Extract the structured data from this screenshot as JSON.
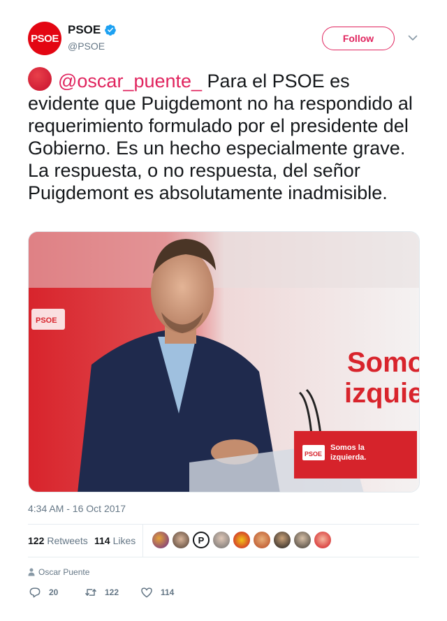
{
  "account": {
    "display_name": "PSOE",
    "handle": "@PSOE",
    "avatar_text": "PSOE",
    "verified": true
  },
  "follow_label": "Follow",
  "tweet": {
    "mention": "@oscar_puente_",
    "text": " Para el PSOE es evidente que Puigdemont no ha respondido al requerimiento formulado por el presidente del Gobierno. Es un hecho especialmente grave. La respuesta, o no respuesta, del señor Puigdemont es absolutamente inadmisible."
  },
  "media": {
    "podium_text_line1": "Somos la",
    "podium_text_line2": "izquierda.",
    "podium_logo": "PSOE",
    "wall_text_line1": "Somo",
    "wall_text_line2": "izquie",
    "wall_logo": "PSOE"
  },
  "timestamp": "4:34 AM - 16 Oct 2017",
  "stats": {
    "retweets_count": "122",
    "retweets_label": "Retweets",
    "likes_count": "114",
    "likes_label": "Likes"
  },
  "reply_context": "Oscar Puente",
  "actions": {
    "reply_count": "20",
    "retweet_count": "122",
    "like_count": "114"
  },
  "colors": {
    "accent": "#e0245e",
    "brand_red": "#e30613",
    "verified_blue": "#1da1f2",
    "muted": "#657786"
  }
}
